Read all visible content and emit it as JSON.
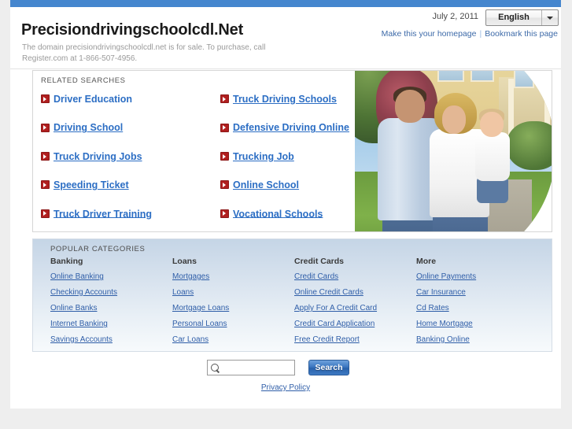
{
  "header": {
    "site_title": "Precisiondrivingschoolcdl.Net",
    "tagline": "The domain precisiondrivingschoolcdl.net is for sale. To purchase, call Register.com at 1-866-507-4956.",
    "date": "July 2, 2011",
    "language": "English",
    "language_caret_icon": "chevron-down-icon",
    "homepage_link": "Make this your homepage",
    "link_separator": "|",
    "bookmark_link": "Bookmark this page"
  },
  "related": {
    "title": "RELATED SEARCHES",
    "bullet_icon": "red-arrow-icon",
    "rows": [
      [
        "Driver Education",
        "Truck Driving Schools"
      ],
      [
        "Driving School",
        "Defensive Driving Online"
      ],
      [
        "Truck Driving Jobs",
        "Trucking Job"
      ],
      [
        "Speeding Ticket",
        "Online School"
      ],
      [
        "Truck Driver Training",
        "Vocational Schools"
      ]
    ],
    "photo_alt": "family-in-front-of-house-photo"
  },
  "popular": {
    "title": "POPULAR CATEGORIES",
    "columns": [
      {
        "heading": "Banking",
        "links": [
          "Online Banking",
          "Checking Accounts",
          "Online Banks",
          "Internet Banking",
          "Savings Accounts"
        ]
      },
      {
        "heading": "Loans",
        "links": [
          "Mortgages",
          "Loans",
          "Mortgage Loans",
          "Personal Loans",
          "Car Loans"
        ]
      },
      {
        "heading": "Credit Cards",
        "links": [
          "Credit Cards",
          "Online Credit Cards",
          "Apply For A Credit Card",
          "Credit Card Application",
          "Free Credit Report"
        ]
      },
      {
        "heading": "More",
        "links": [
          "Online Payments",
          "Car Insurance",
          "Cd Rates",
          "Home Mortgage",
          "Banking Online"
        ]
      }
    ]
  },
  "search": {
    "value": "",
    "placeholder": "",
    "icon": "magnifier-icon",
    "button_label": "Search"
  },
  "footer": {
    "privacy_label": "Privacy Policy"
  },
  "colors": {
    "topbar_blue": "#4586ce",
    "link_blue": "#2c6ec4",
    "bullet_red": "#b01f1f",
    "page_bg": "#eeeeee",
    "category_bg_top": "#c5d5e6"
  }
}
